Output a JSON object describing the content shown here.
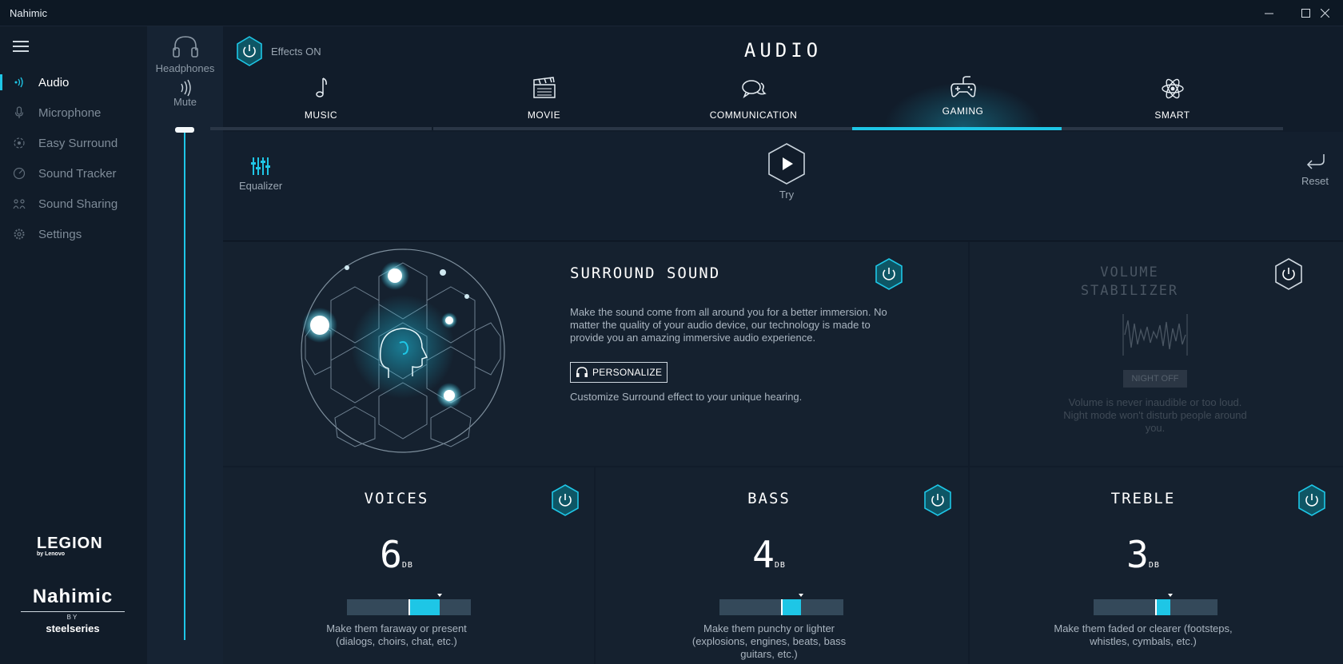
{
  "window": {
    "title": "Nahimic"
  },
  "sidebar": {
    "items": [
      {
        "label": "Audio",
        "icon": "audio-waves-icon",
        "active": true
      },
      {
        "label": "Microphone",
        "icon": "microphone-icon"
      },
      {
        "label": "Easy Surround",
        "icon": "surround-icon"
      },
      {
        "label": "Sound Tracker",
        "icon": "tracker-icon"
      },
      {
        "label": "Sound Sharing",
        "icon": "sharing-icon"
      },
      {
        "label": "Settings",
        "icon": "gear-icon"
      }
    ],
    "brand": {
      "legion": "LEGION",
      "legion_sub": "by Lenovo",
      "nahimic": "Nahimic",
      "by": "BY",
      "steelseries": "steelseries"
    }
  },
  "device": {
    "name": "Headphones",
    "mute_label": "Mute",
    "volume_percent": 100
  },
  "header": {
    "effects_label": "Effects ON",
    "title": "AUDIO"
  },
  "tabs": [
    {
      "label": "MUSIC",
      "icon": "music-note-icon"
    },
    {
      "label": "MOVIE",
      "icon": "clapperboard-icon"
    },
    {
      "label": "COMMUNICATION",
      "icon": "chat-bubbles-icon"
    },
    {
      "label": "GAMING",
      "icon": "gamepad-icon",
      "active": true
    },
    {
      "label": "SMART",
      "icon": "atom-icon"
    }
  ],
  "toolbar": {
    "equalizer": "Equalizer",
    "try": "Try",
    "reset": "Reset"
  },
  "surround": {
    "title": "SURROUND SOUND",
    "description": "Make the sound come from all around you for a better immersion. No matter the quality of your audio device, our technology is made to provide you an amazing immersive audio experience.",
    "personalize": "PERSONALIZE",
    "personalize_hint": "Customize Surround effect to your unique hearing."
  },
  "volume_stabilizer": {
    "title_line1": "VOLUME",
    "title_line2": "STABILIZER",
    "night_button": "NIGHT OFF",
    "description": "Volume is never inaudible or too loud. Night mode won't disturb people around you."
  },
  "voices": {
    "title": "VOICES",
    "value": "6",
    "unit": "DB",
    "slider_fraction": 0.75,
    "description": "Make them faraway or present (dialogs, choirs, chat, etc.)"
  },
  "bass": {
    "title": "BASS",
    "value": "4",
    "unit": "DB",
    "slider_fraction": 0.66,
    "description": "Make them punchy or lighter (explosions, engines, beats, bass guitars, etc.)"
  },
  "treble": {
    "title": "TREBLE",
    "value": "3",
    "unit": "DB",
    "slider_fraction": 0.62,
    "description": "Make them faded or clearer (footsteps, whistles, cymbals, etc.)"
  },
  "colors": {
    "accent": "#1ec6e6",
    "background": "#111c2a",
    "panel": "#15212f"
  }
}
